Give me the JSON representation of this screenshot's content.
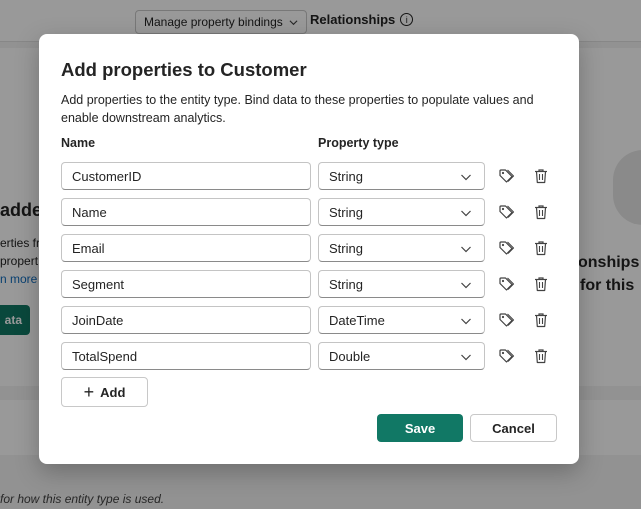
{
  "background": {
    "manage_label": "Manage property bindings",
    "relationships_label": "Relationships",
    "left_title": "adde",
    "left_text1": "erties fr",
    "left_text2": "propert",
    "left_link": "n more",
    "left_button": "ata",
    "right_title1": "onships",
    "right_title2": "for this",
    "footnote": "for how this entity type is used."
  },
  "dialog": {
    "title": "Add properties to Customer",
    "description": "Add properties to the entity type. Bind data to these properties to populate values and enable downstream analytics.",
    "col_name": "Name",
    "col_type": "Property type",
    "properties": [
      {
        "name": "CustomerID",
        "type": "String"
      },
      {
        "name": "Name",
        "type": "String"
      },
      {
        "name": "Email",
        "type": "String"
      },
      {
        "name": "Segment",
        "type": "String"
      },
      {
        "name": "JoinDate",
        "type": "DateTime"
      },
      {
        "name": "TotalSpend",
        "type": "Double"
      }
    ],
    "add_label": "Add",
    "save_label": "Save",
    "cancel_label": "Cancel"
  },
  "colors": {
    "accent": "#117865",
    "link": "#0f6cbd"
  }
}
